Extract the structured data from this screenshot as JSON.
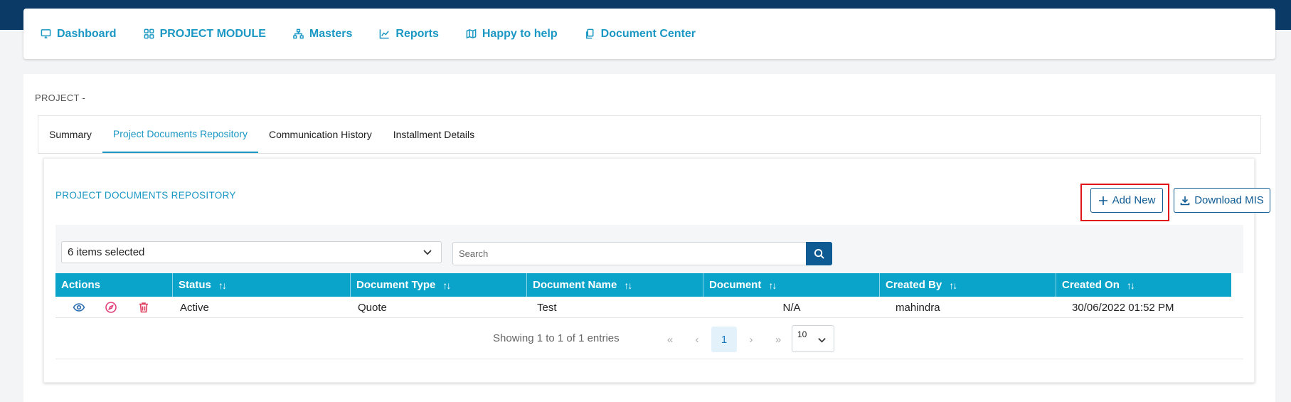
{
  "nav": {
    "items": [
      {
        "label": "Dashboard",
        "icon": "monitor-icon"
      },
      {
        "label": "PROJECT MODULE",
        "icon": "grid-icon"
      },
      {
        "label": "Masters",
        "icon": "sitemap-icon"
      },
      {
        "label": "Reports",
        "icon": "chart-icon"
      },
      {
        "label": "Happy to help",
        "icon": "map-icon"
      },
      {
        "label": "Document Center",
        "icon": "documents-icon"
      }
    ]
  },
  "page": {
    "project_title": "PROJECT -"
  },
  "tabs": [
    {
      "label": "Summary",
      "active": false
    },
    {
      "label": "Project Documents Repository",
      "active": true
    },
    {
      "label": "Communication History",
      "active": false
    },
    {
      "label": "Installment Details",
      "active": false
    }
  ],
  "repository": {
    "title": "PROJECT DOCUMENTS REPOSITORY",
    "add_new_label": "Add New",
    "download_label": "Download MIS",
    "column_filter_value": "6 items selected",
    "search_placeholder": "Search"
  },
  "table": {
    "columns": [
      "Actions",
      "Status",
      "Document Type",
      "Document Name",
      "Document",
      "Created By",
      "Created On"
    ],
    "sort_glyph": "↑↓",
    "rows": [
      {
        "status": "Active",
        "document_type": "Quote",
        "document_name": "Test",
        "document": "N/A",
        "created_by": "mahindra",
        "created_on": "30/06/2022 01:52 PM"
      }
    ]
  },
  "pagination": {
    "summary": "Showing 1 to 1 of 1 entries",
    "first": "«",
    "prev": "‹",
    "current_page": "1",
    "next": "›",
    "last": "»",
    "page_size": "10"
  },
  "colors": {
    "top_band": "#0b3a66",
    "accent": "#1a97c3",
    "table_header": "#0aa3c9",
    "primary_button": "#0e5a92",
    "highlight": "#e0151a",
    "view_icon": "#2a6bb0",
    "edit_icon": "#e0407a",
    "delete_icon": "#e04060"
  }
}
